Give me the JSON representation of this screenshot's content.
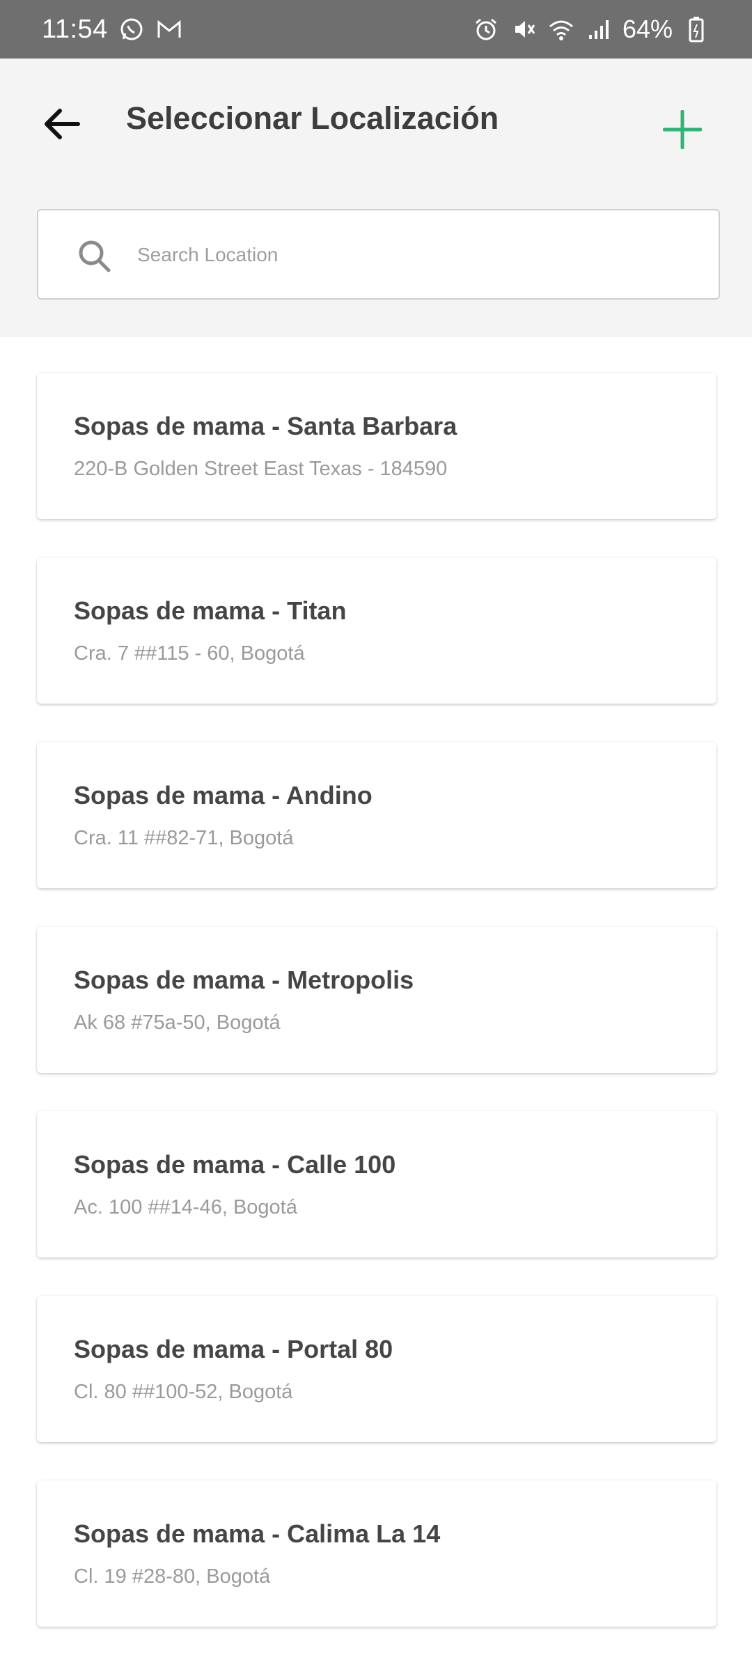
{
  "status_bar": {
    "time": "11:54",
    "battery": "64%",
    "icons": [
      "whatsapp-icon",
      "gmail-icon",
      "alarm-icon",
      "mute-icon",
      "wifi-icon",
      "signal-icon",
      "battery-icon"
    ]
  },
  "header": {
    "title": "Seleccionar Localización",
    "accent_color": "#2bb673"
  },
  "search": {
    "placeholder": "Search Location",
    "value": ""
  },
  "locations": [
    {
      "name": "Sopas de mama - Santa Barbara",
      "address": "220-B Golden Street East Texas - 184590"
    },
    {
      "name": "Sopas de mama - Titan",
      "address": "Cra. 7 ##115 - 60, Bogotá"
    },
    {
      "name": "Sopas de mama - Andino",
      "address": "Cra. 11 ##82-71, Bogotá"
    },
    {
      "name": "Sopas de mama - Metropolis",
      "address": "Ak 68 #75a-50, Bogotá"
    },
    {
      "name": "Sopas de mama - Calle 100",
      "address": "Ac. 100 ##14-46, Bogotá"
    },
    {
      "name": "Sopas de mama - Portal 80",
      "address": "Cl. 80 ##100-52, Bogotá"
    },
    {
      "name": "Sopas de mama - Calima La 14",
      "address": "Cl. 19 #28-80, Bogotá"
    }
  ]
}
